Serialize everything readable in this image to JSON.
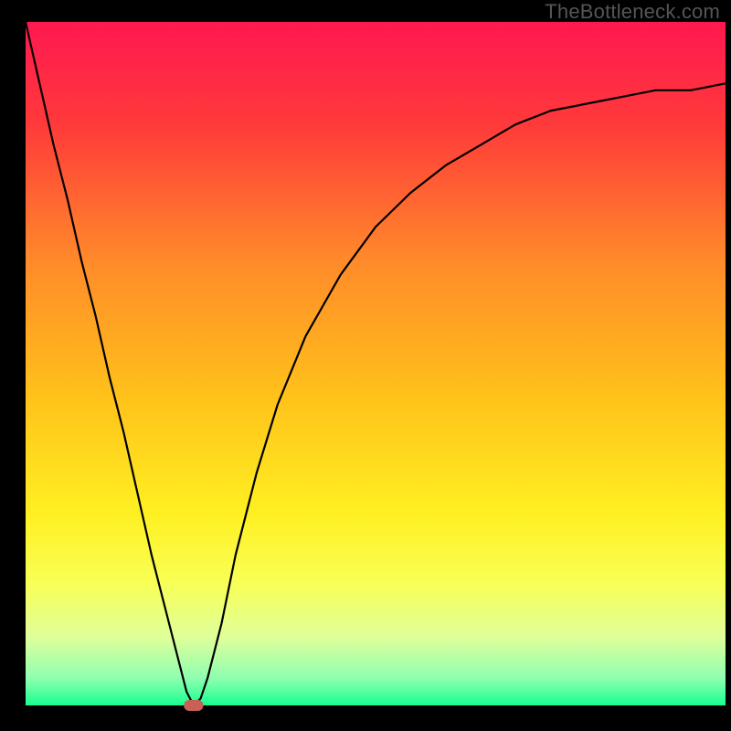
{
  "watermark": "TheBottleneck.com",
  "chart_data": {
    "type": "line",
    "title": "",
    "xlabel": "",
    "ylabel": "",
    "xlim": [
      0,
      100
    ],
    "ylim": [
      0,
      100
    ],
    "grid": false,
    "background": {
      "type": "vertical-gradient",
      "stops": [
        {
          "offset": 0.0,
          "color": "#ff1850"
        },
        {
          "offset": 0.15,
          "color": "#ff3a3a"
        },
        {
          "offset": 0.35,
          "color": "#ff8a2a"
        },
        {
          "offset": 0.55,
          "color": "#ffc21a"
        },
        {
          "offset": 0.72,
          "color": "#fff022"
        },
        {
          "offset": 0.82,
          "color": "#f8ff55"
        },
        {
          "offset": 0.9,
          "color": "#dfff9a"
        },
        {
          "offset": 0.96,
          "color": "#8fffb0"
        },
        {
          "offset": 1.0,
          "color": "#18ff90"
        }
      ]
    },
    "curve": {
      "x": [
        0,
        2,
        4,
        6,
        8,
        10,
        12,
        14,
        16,
        18,
        20,
        22,
        23,
        24,
        25,
        26,
        28,
        30,
        33,
        36,
        40,
        45,
        50,
        55,
        60,
        65,
        70,
        75,
        80,
        85,
        90,
        95,
        100
      ],
      "y": [
        100,
        91,
        82,
        74,
        65,
        57,
        48,
        40,
        31,
        22,
        14,
        6,
        2,
        0,
        1,
        4,
        12,
        22,
        34,
        44,
        54,
        63,
        70,
        75,
        79,
        82,
        85,
        87,
        88,
        89,
        90,
        90,
        91
      ],
      "stroke": "#000000",
      "stroke_width": 2.2
    },
    "marker": {
      "x": 24,
      "y": 0,
      "shape": "rounded-rect",
      "fill": "#c86058",
      "width_frac": 0.028,
      "height_frac": 0.016
    },
    "frame": {
      "stroke": "#000000",
      "left_width": 28,
      "bottom_width": 28,
      "right_width": 0,
      "top_width": 0
    }
  }
}
